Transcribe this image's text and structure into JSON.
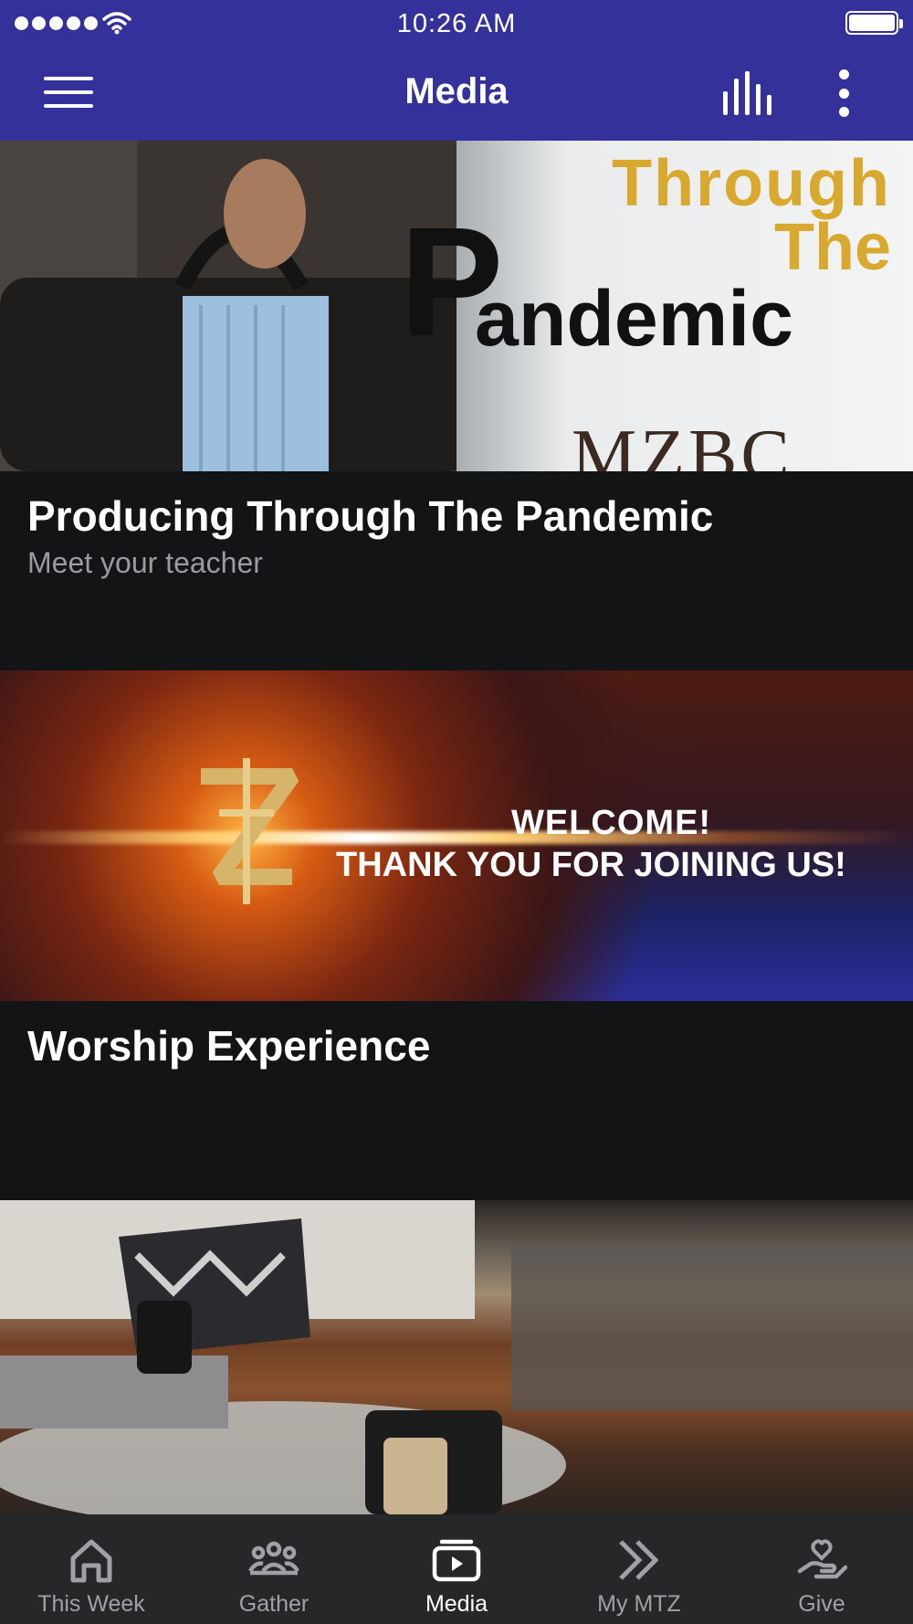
{
  "status_bar": {
    "time": "10:26 AM"
  },
  "header": {
    "title": "Media"
  },
  "feed": [
    {
      "title": "Producing Through The Pandemic",
      "subtitle": "Meet your teacher",
      "banner": {
        "line1": "Through",
        "line2": "The",
        "big_letter": "P",
        "word": "andemic",
        "logo_text": "MZBC"
      }
    },
    {
      "title": "Worship Experience",
      "banner": {
        "line1": "WELCOME!",
        "line2": "THANK YOU FOR JOINING US!"
      }
    },
    {
      "title": ""
    }
  ],
  "tabs": [
    {
      "label": "This Week",
      "icon": "home-icon",
      "active": false
    },
    {
      "label": "Gather",
      "icon": "group-icon",
      "active": false
    },
    {
      "label": "Media",
      "icon": "media-icon",
      "active": true
    },
    {
      "label": "My MTZ",
      "icon": "double-chevron-icon",
      "active": false
    },
    {
      "label": "Give",
      "icon": "give-icon",
      "active": false
    }
  ],
  "colors": {
    "header": "#34329a",
    "background": "#131416",
    "tabbar": "#262729",
    "accent_gold": "#d9a82f"
  }
}
